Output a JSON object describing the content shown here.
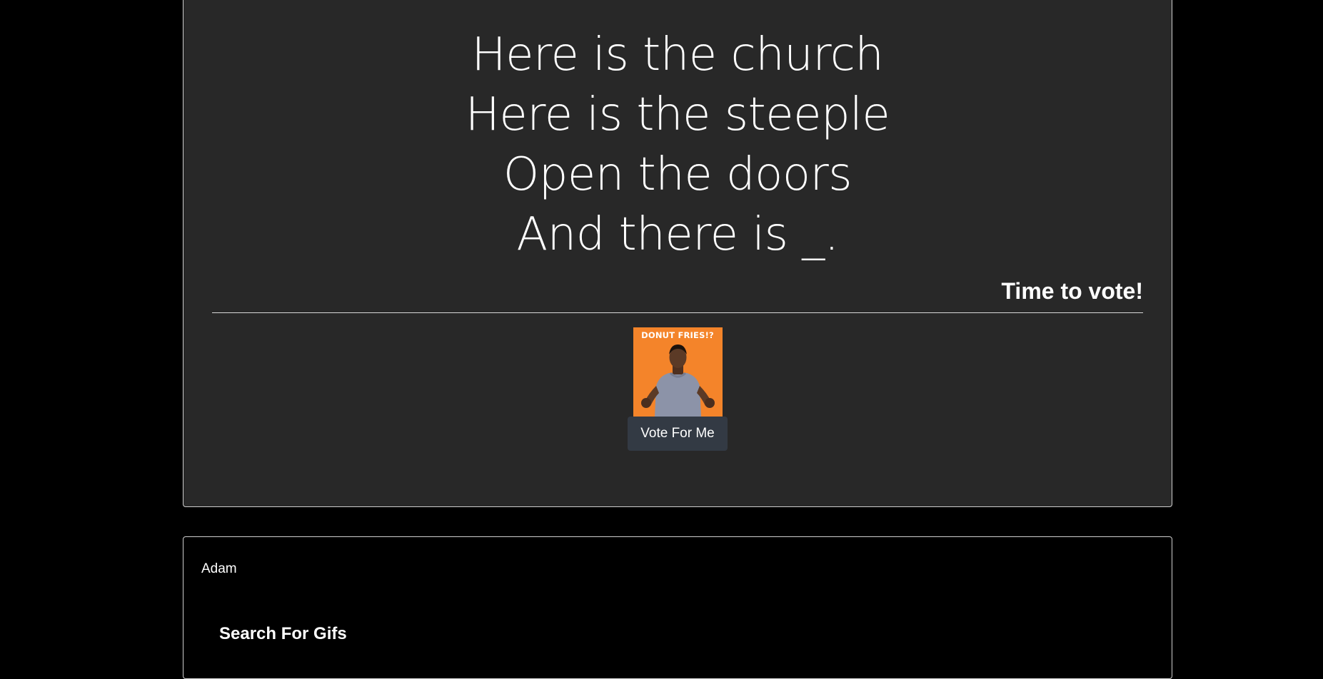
{
  "prompt": {
    "lines": [
      "Here is the church",
      "Here is the steeple",
      "Open the doors",
      "And there is _."
    ]
  },
  "status": "Time to vote!",
  "submission": {
    "gif_caption": "DONUT FRIES!?",
    "vote_label": "Vote For Me"
  },
  "player": {
    "name": "Adam",
    "search_heading": "Search For Gifs"
  },
  "colors": {
    "page_bg": "#000000",
    "card_bg": "#282828",
    "gif_bg": "#f4842a",
    "button_bg": "#333a44"
  }
}
